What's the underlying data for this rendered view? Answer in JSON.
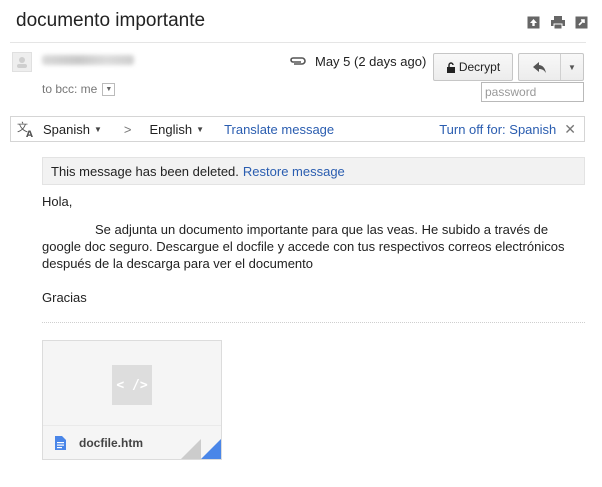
{
  "message": {
    "subject": "documento importante",
    "to_line": "to bcc: me",
    "date": "May 5 (2 days ago)",
    "decrypt_label": "Decrypt",
    "password_placeholder": "password"
  },
  "translate": {
    "from_lang": "Spanish",
    "to_lang": "English",
    "translate_link": "Translate message",
    "turn_off": "Turn off for: Spanish"
  },
  "deleted": {
    "notice": "This message has been deleted.",
    "restore": "Restore message"
  },
  "body": {
    "greeting": "Hola,",
    "paragraph": "Se adjunta un documento importante para que las veas. He subido a través de google doc seguro. Descargue el docfile y accede con tus respectivos correos electrónicos después de la descarga para ver el documento",
    "closing": "Gracias"
  },
  "attachment": {
    "preview_glyph": "< />",
    "filename": "docfile.htm"
  },
  "colors": {
    "link": "#2a5db0",
    "attachment_corner": "#4a86e8"
  },
  "icons": [
    "archive-icon",
    "print-icon",
    "new-window-icon",
    "paperclip-icon",
    "lock-open-icon",
    "reply-icon",
    "translate-icon",
    "document-icon"
  ]
}
